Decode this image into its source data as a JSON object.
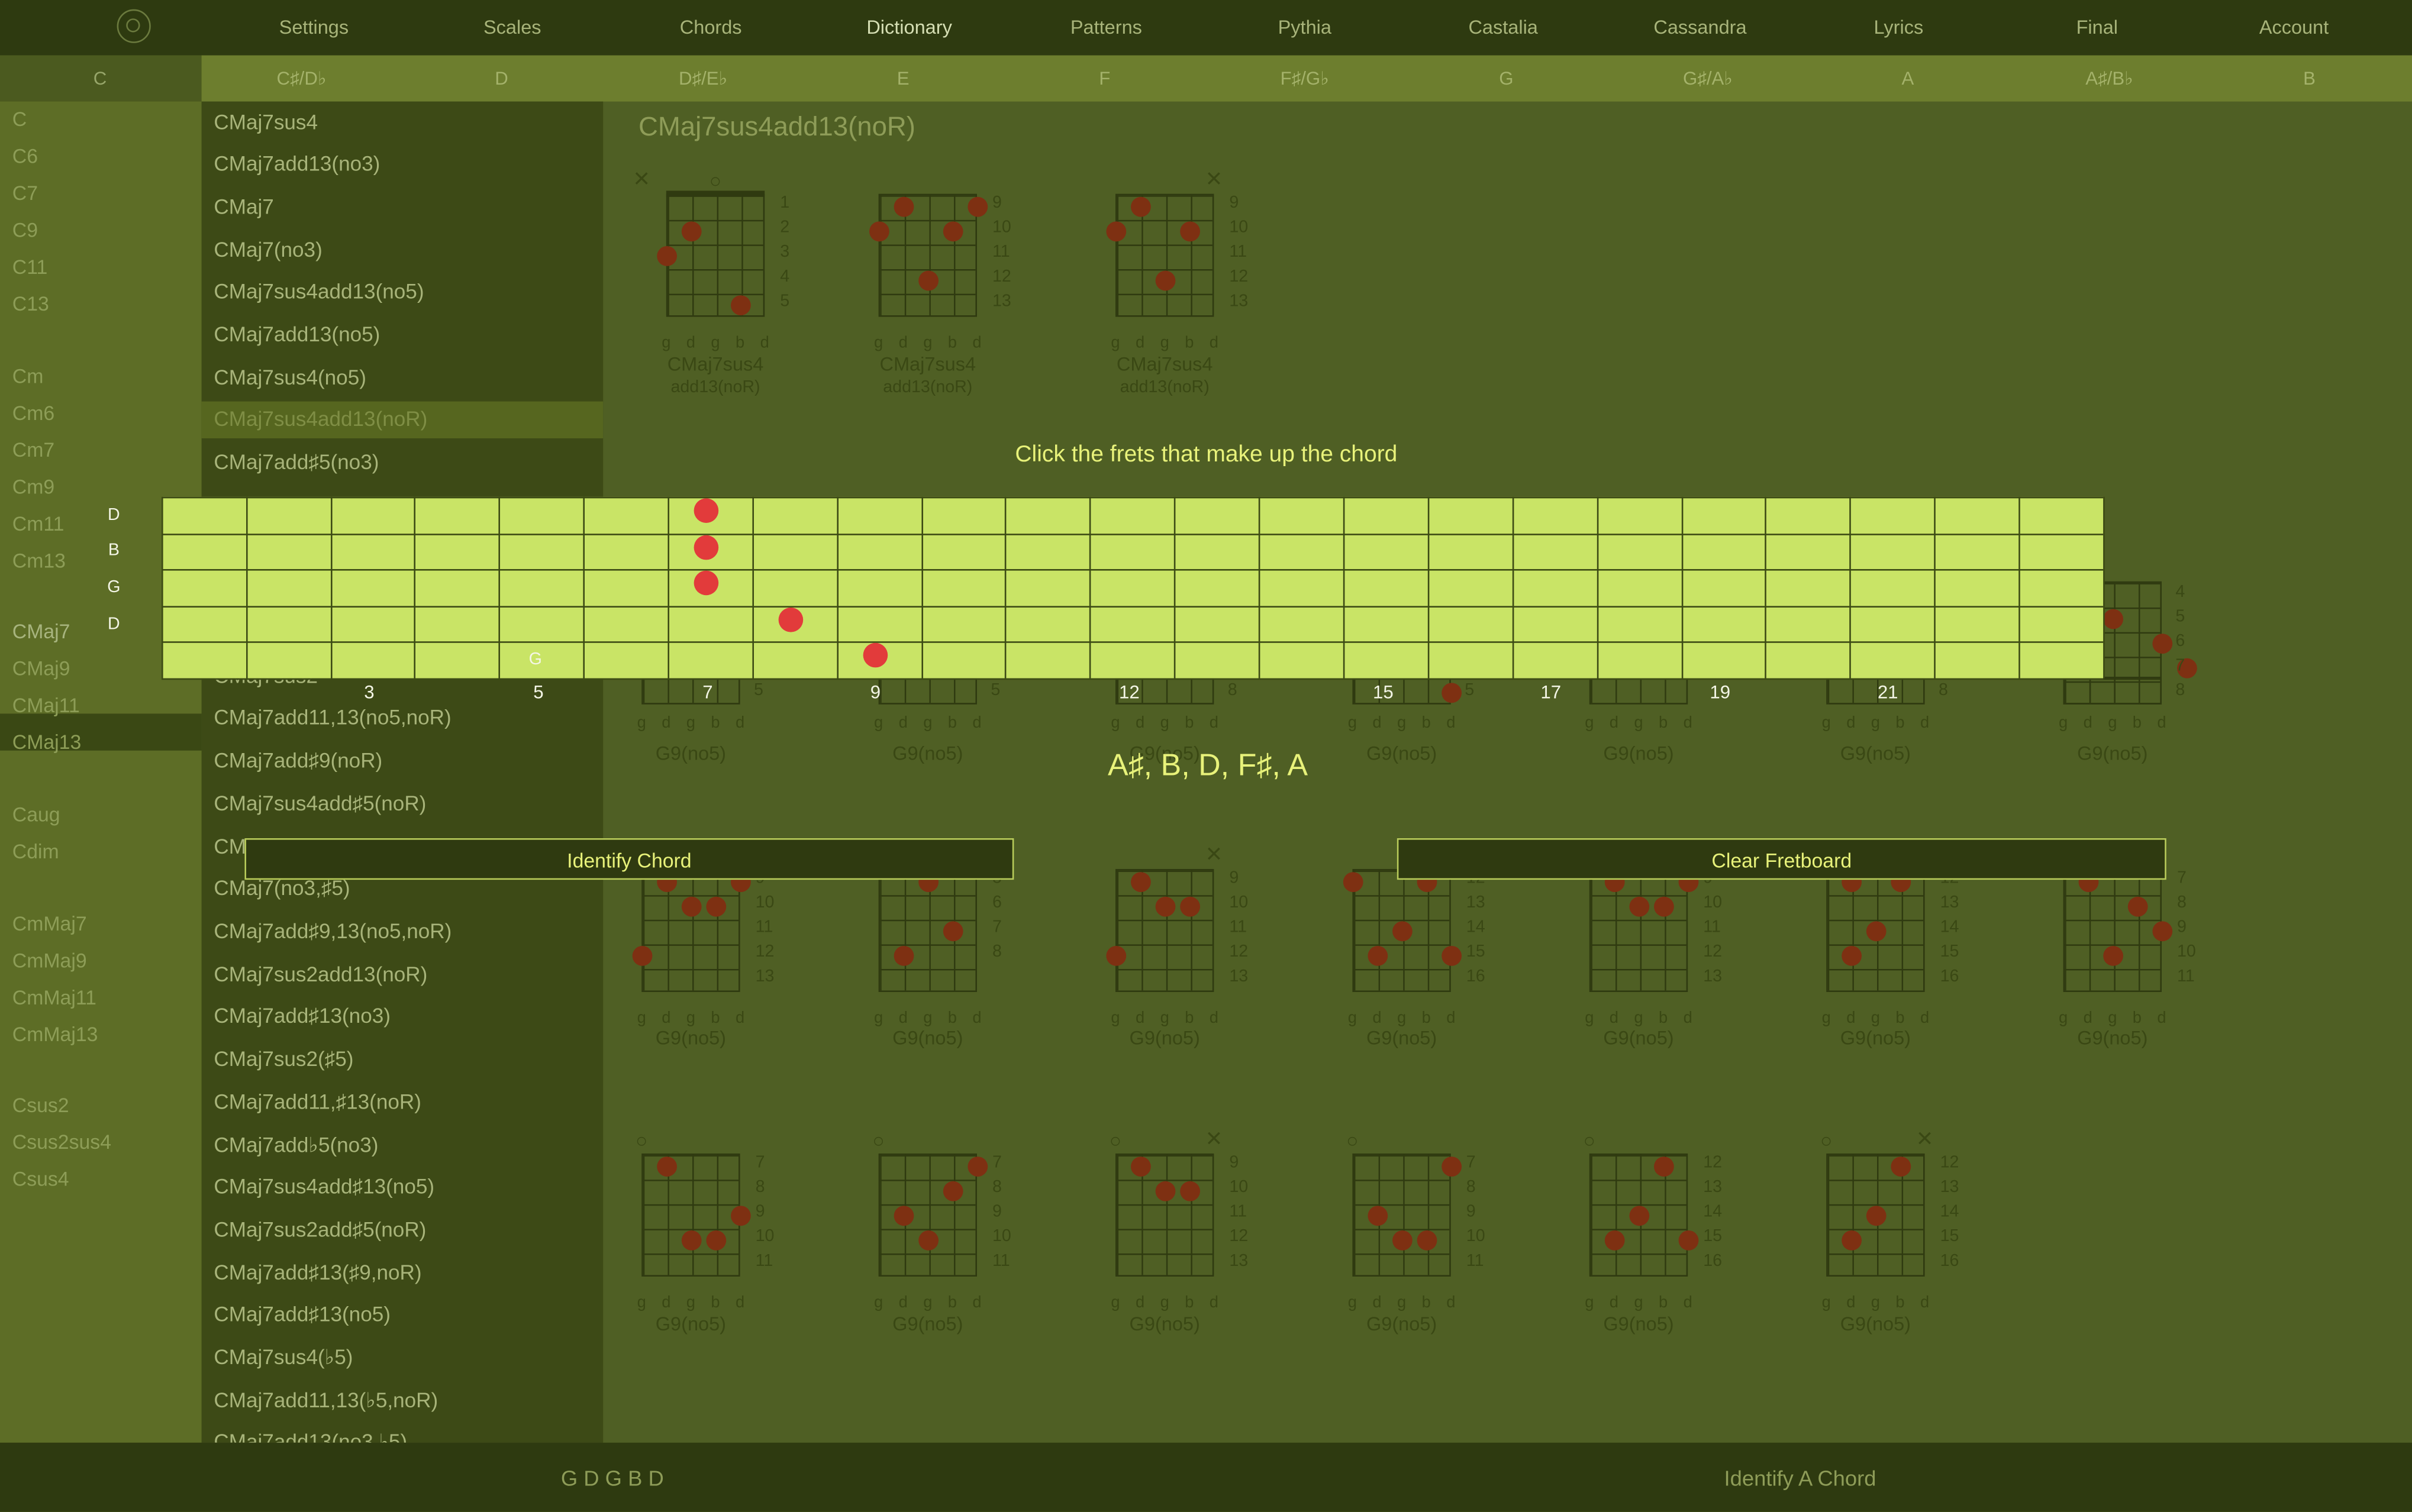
{
  "nav": [
    "Settings",
    "Scales",
    "Chords",
    "Dictionary",
    "Patterns",
    "Pythia",
    "Castalia",
    "Cassandra",
    "Lyrics",
    "Final",
    "Account"
  ],
  "nav_active": "Dictionary",
  "keys": [
    "C",
    "C♯/D♭",
    "D",
    "D♯/E♭",
    "E",
    "F",
    "F♯/G♭",
    "G",
    "G♯/A♭",
    "A",
    "A♯/B♭",
    "B"
  ],
  "chord_types": [
    "C",
    "C6",
    "C7",
    "C9",
    "C11",
    "C13",
    "Cm",
    "Cm6",
    "Cm7",
    "Cm9",
    "Cm11",
    "Cm13",
    "CMaj7",
    "CMaj9",
    "CMaj11",
    "CMaj13",
    "Caug",
    "Cdim",
    "CmMaj7",
    "CmMaj9",
    "CmMaj11",
    "CmMaj13",
    "Csus2",
    "Csus2sus4",
    "Csus4"
  ],
  "chord_type_selected": "CMaj7",
  "chord_list": [
    "CMaj7sus4",
    "CMaj7add13(no3)",
    "CMaj7",
    "CMaj7(no3)",
    "CMaj7sus4add13(no5)",
    "CMaj7add13(no5)",
    "CMaj7sus4(no5)",
    "CMaj7sus4add13(noR)",
    "CMaj7add♯5(no3)",
    "CMaj7sus2",
    "CMaj7add11,13(no5,noR)",
    "CMaj7add♯9(noR)",
    "CMaj7sus4add♯5(noR)",
    "CMaj7sus2add13(no5)",
    "CMaj7(no3,♯5)",
    "CMaj7add♯9,13(no5,noR)",
    "CMaj7sus2add13(noR)",
    "CMaj7add♯13(no3)",
    "CMaj7sus2(♯5)",
    "CMaj7add11,♯13(noR)",
    "CMaj7add♭5(no3)",
    "CMaj7sus4add♯13(no5)",
    "CMaj7sus2add♯5(noR)",
    "CMaj7add♯13(♯9,noR)",
    "CMaj7add♯13(no5)",
    "CMaj7sus4(♭5)",
    "CMaj7add11,13(♭5,noR)",
    "CMaj7add13(no3,♭5)"
  ],
  "chord_list_selected": "CMaj7sus4add13(noR)",
  "main_title": "CMaj7sus4add13(noR)",
  "string_names": [
    "g",
    "d",
    "g",
    "b",
    "d"
  ],
  "top_diagrams": [
    {
      "name": "CMaj7sus4",
      "sub": "add13(noR)",
      "frets": [
        "1",
        "2",
        "3",
        "4",
        "5"
      ]
    },
    {
      "name": "CMaj7sus4",
      "sub": "add13(noR)",
      "frets": [
        "9",
        "10",
        "11",
        "12",
        "13"
      ]
    },
    {
      "name": "CMaj7sus4",
      "sub": "add13(noR)",
      "frets": [
        "9",
        "10",
        "11",
        "12",
        "13"
      ]
    }
  ],
  "row2_names": [
    "G9(no5)",
    "G9(no5)",
    "G9(no5)",
    "G9(no5)",
    "G9(no5)",
    "G9(no5)",
    "G9(no5)"
  ],
  "row2_frets": [
    "5",
    "5",
    "8",
    "5",
    "8",
    "4",
    "5",
    "6",
    "7",
    "8"
  ],
  "row3": [
    {
      "name": "G9(no5)",
      "frets": [
        "9",
        "10",
        "11",
        "12",
        "13"
      ]
    },
    {
      "name": "G9(no5)",
      "frets": [
        "5",
        "6",
        "7",
        "8"
      ]
    },
    {
      "name": "G9(no5)",
      "frets": [
        "9",
        "10",
        "11",
        "12",
        "13"
      ]
    },
    {
      "name": "G9(no5)",
      "frets": [
        "12",
        "13",
        "14",
        "15",
        "16"
      ]
    },
    {
      "name": "G9(no5)",
      "frets": [
        "9",
        "10",
        "11",
        "12",
        "13"
      ]
    },
    {
      "name": "G9(no5)",
      "frets": [
        "12",
        "13",
        "14",
        "15",
        "16"
      ]
    },
    {
      "name": "G9(no5)",
      "frets": [
        "7",
        "8",
        "9",
        "10",
        "11"
      ]
    }
  ],
  "row4": [
    {
      "name": "G9(no5)",
      "frets": [
        "7",
        "8",
        "9",
        "10",
        "11"
      ]
    },
    {
      "name": "G9(no5)",
      "frets": [
        "7",
        "8",
        "9",
        "10",
        "11"
      ]
    },
    {
      "name": "G9(no5)",
      "frets": [
        "9",
        "10",
        "11",
        "12",
        "13"
      ]
    },
    {
      "name": "G9(no5)",
      "frets": [
        "7",
        "8",
        "9",
        "10",
        "11"
      ]
    },
    {
      "name": "G9(no5)",
      "frets": [
        "12",
        "13",
        "14",
        "15",
        "16"
      ]
    },
    {
      "name": "G9(no5)",
      "frets": [
        "12",
        "13",
        "14",
        "15",
        "16"
      ]
    }
  ],
  "overlay": {
    "prompt": "Click the frets that make up the chord",
    "string_labels": [
      "D",
      "B",
      "G",
      "D"
    ],
    "low_string_label": "G",
    "fret_numbers": [
      "3",
      "5",
      "7",
      "9",
      "12",
      "15",
      "17",
      "19",
      "21"
    ],
    "selected_notes": "A♯, B, D, F♯, A",
    "identify_button": "Identify Chord",
    "clear_button": "Clear Fretboard",
    "dot_color": "#e23b3b",
    "board_color": "#c9e466"
  },
  "bottom": {
    "tuning": "G D G B D",
    "mode_label": "Identify A Chord"
  }
}
